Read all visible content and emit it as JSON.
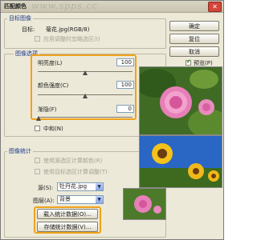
{
  "window": {
    "title": "匹配颜色",
    "watermark": "www.spps.cc"
  },
  "target_image": {
    "legend": "目标图像",
    "target_label": "目标:",
    "target_value": "菊花.jpg(RGB/8)",
    "ignore_selection_label": "应用调整时忽略选区(I)"
  },
  "image_options": {
    "legend": "图像选项",
    "luminance": {
      "label": "明亮度(L)",
      "value": "100",
      "level": 0.5
    },
    "color_intensity": {
      "label": "颜色强度(C)",
      "value": "100",
      "level": 0.5
    },
    "fade": {
      "label": "渐隐(F)",
      "value": "0",
      "level": 0.0
    },
    "neutralize_label": "中和(N)"
  },
  "image_stats": {
    "legend": "图像统计",
    "use_source_selection_label": "使用源选区计算颜色(R)",
    "use_target_selection_label": "使用目标选区计算调整(T)",
    "source_label": "源(S):",
    "source_value": "牡丹花.jpg",
    "layer_label": "图层(A):",
    "layer_value": "背景",
    "load_stats_button": "载入统计数据(O)...",
    "save_stats_button": "存储统计数据(V)..."
  },
  "buttons": {
    "ok": "确定",
    "reset": "复位",
    "cancel": "取消"
  },
  "preview": {
    "label": "预览(P)",
    "checked": true
  }
}
